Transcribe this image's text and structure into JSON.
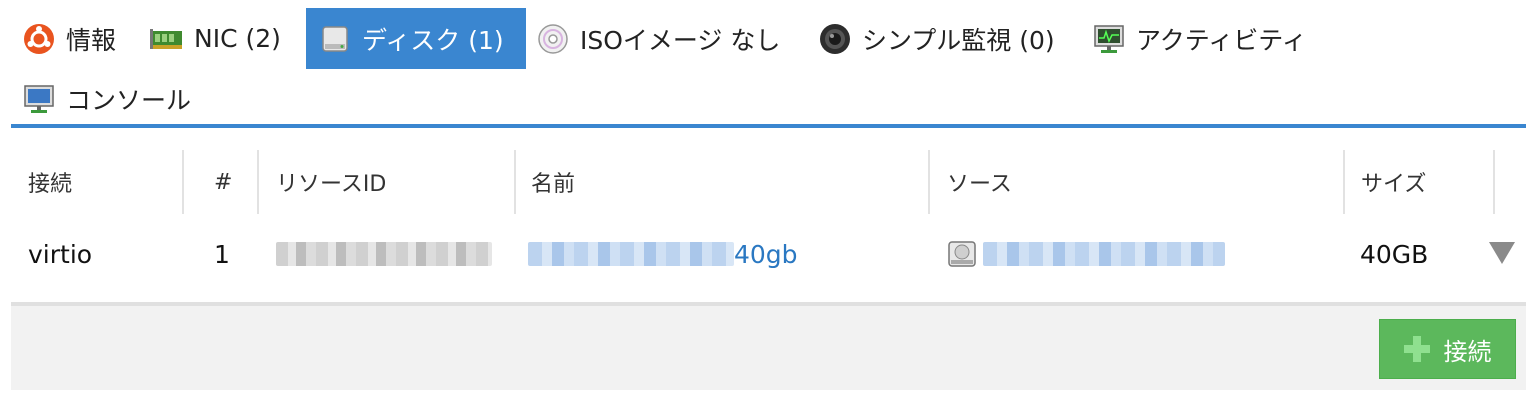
{
  "tabs": [
    {
      "label": "情報",
      "icon": "ubuntu-icon"
    },
    {
      "label": "NIC (2)",
      "icon": "network-card-icon"
    },
    {
      "label": "ディスク (1)",
      "icon": "disk-icon",
      "active": true
    },
    {
      "label": "ISOイメージ なし",
      "icon": "cd-icon"
    },
    {
      "label": "シンプル監視 (0)",
      "icon": "camera-lens-icon"
    },
    {
      "label": "アクティビティ",
      "icon": "activity-monitor-icon"
    },
    {
      "label": "コンソール",
      "icon": "console-monitor-icon"
    }
  ],
  "table": {
    "headers": [
      "接続",
      "#",
      "リソースID",
      "名前",
      "ソース",
      "サイズ"
    ],
    "rows": [
      {
        "connection": "virtio",
        "index": "1",
        "resource_id": "",
        "name_suffix": "40gb",
        "source": "",
        "size": "40GB"
      }
    ]
  },
  "footer": {
    "add_button_label": "接続"
  },
  "colors": {
    "accent": "#3a86d0",
    "link": "#2a78c2",
    "add_button": "#5cb85c"
  }
}
